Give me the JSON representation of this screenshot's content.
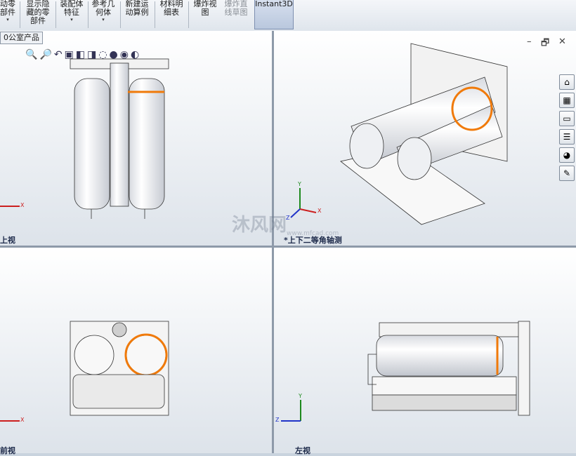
{
  "toolbar": {
    "items": [
      {
        "label": "动零\n部件",
        "arrow": "▾"
      },
      {
        "label": "显示隐\n藏的零\n部件",
        "arrow": ""
      },
      {
        "label": "装配体\n特征",
        "arrow": "▾"
      },
      {
        "label": "参考几\n何体",
        "arrow": "▾"
      },
      {
        "label": "新建运\n动算例",
        "arrow": ""
      },
      {
        "label": "材料明\n细表",
        "arrow": ""
      },
      {
        "label": "爆炸视\n图",
        "arrow": ""
      },
      {
        "label": "爆炸直\n线草图",
        "arrow": ""
      },
      {
        "label": "Instant3D",
        "arrow": ""
      }
    ]
  },
  "document_tab": "0公室产品",
  "viewports": {
    "top_left_label": "上视",
    "top_right_label": "*上下二等角轴测",
    "bottom_left_label": "前视",
    "bottom_right_label": "左视"
  },
  "window_controls": {
    "minimize": "–",
    "restore": "🗗",
    "close": "✕"
  },
  "triad": {
    "x": "X",
    "y": "Y",
    "z": "Z"
  },
  "watermark": {
    "text": "沐风网",
    "url": "www.mfcad.com"
  },
  "colors": {
    "highlight": "#f07a0a",
    "axis_x": "#cc1f1f",
    "axis_y": "#1e8a1e",
    "axis_z": "#2033c8"
  }
}
